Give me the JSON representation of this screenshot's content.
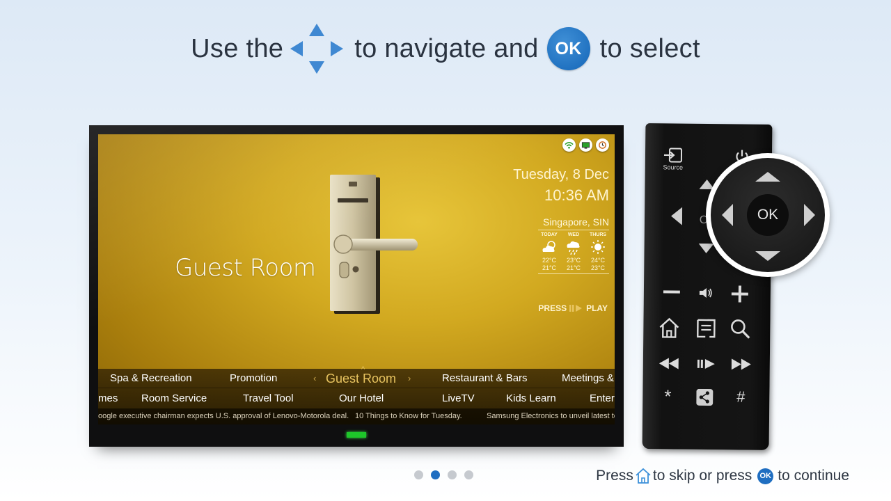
{
  "heading": {
    "part1": "Use the",
    "dpad_icon": "dpad-arrows-icon",
    "part2": "to navigate and",
    "ok_label": "OK",
    "part3": "to select"
  },
  "tv": {
    "status_icons": [
      "wifi-icon",
      "screen-icon",
      "clock-alert-icon"
    ],
    "date": "Tuesday, 8 Dec",
    "time": "10:36 AM",
    "weather": {
      "city": "Singapore, SIN",
      "days": [
        {
          "label": "TODAY",
          "icon": "partly-cloudy-icon",
          "high": "22°C",
          "low": "21°C"
        },
        {
          "label": "WED",
          "icon": "rain-cloud-icon",
          "high": "23°C",
          "low": "21°C"
        },
        {
          "label": "THURS",
          "icon": "sun-icon",
          "high": "24°C",
          "low": "23°C"
        }
      ]
    },
    "press_play": {
      "press": "PRESS",
      "play": "PLAY"
    },
    "page_title": "Guest Room",
    "menu_row1": [
      "Spa & Recreation",
      "Promotion",
      "Guest Room",
      "Restaurant & Bars",
      "Meetings &"
    ],
    "menu_row2": [
      "mes",
      "Room Service",
      "Travel Tool",
      "Our Hotel",
      "LiveTV",
      "Kids Learn",
      "Enter"
    ],
    "ticker": [
      "oogle executive chairman expects U.S. approval of Lenovo-Motorola deal.",
      "10 Things to Know for Tuesday.",
      "Samsung Electronics to unveil latest te"
    ]
  },
  "remote": {
    "source_label": "Source",
    "ok_label": "OK",
    "buttons": [
      "source-button",
      "power-button",
      "volume-down-button",
      "mute-button",
      "volume-up-button",
      "home-button",
      "guide-button",
      "search-button",
      "rewind-button",
      "play-pause-button",
      "fast-forward-button",
      "star-button",
      "share-button",
      "hash-button"
    ]
  },
  "pagination": {
    "total": 4,
    "active": 2
  },
  "footer": {
    "part1": "Press",
    "part2": "to skip or press",
    "ok_label": "OK",
    "part3": "to continue"
  },
  "colors": {
    "accent_blue": "#1f6ec1",
    "screen_gold": "#d2a920",
    "led_green": "#1ec62a"
  }
}
